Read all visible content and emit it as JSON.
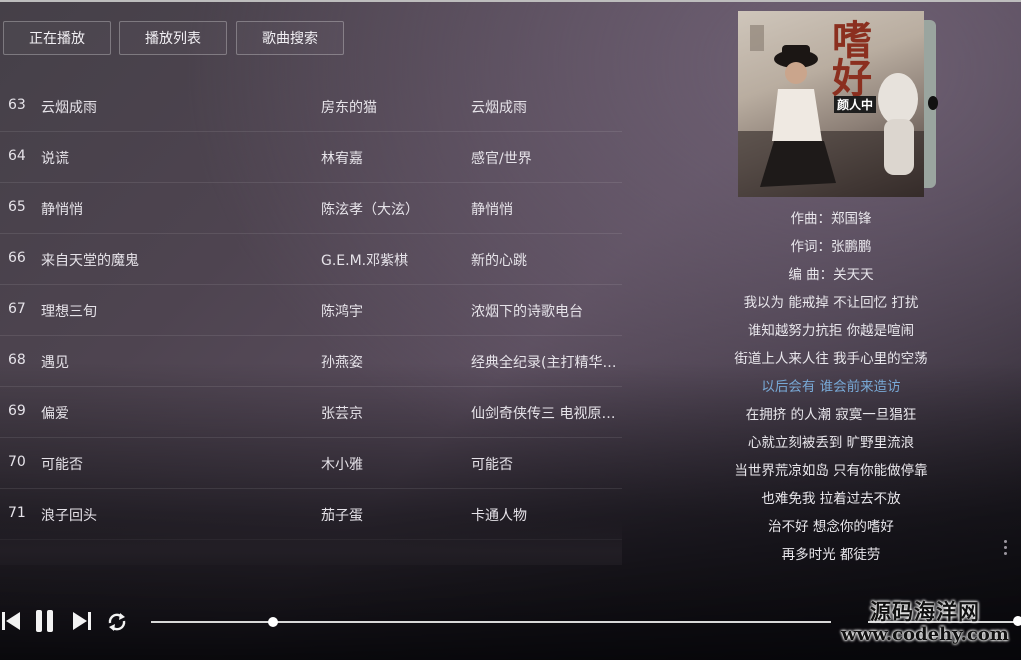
{
  "tabs": [
    {
      "label": "正在播放"
    },
    {
      "label": "播放列表"
    },
    {
      "label": "歌曲搜索"
    }
  ],
  "songs": [
    {
      "num": "63",
      "title": "云烟成雨",
      "artist": "房东的猫",
      "album": "云烟成雨"
    },
    {
      "num": "64",
      "title": "说谎",
      "artist": "林宥嘉",
      "album": "感官/世界"
    },
    {
      "num": "65",
      "title": "静悄悄",
      "artist": "陈泫孝（大泫）",
      "album": "静悄悄"
    },
    {
      "num": "66",
      "title": "来自天堂的魔鬼",
      "artist": "G.E.M.邓紫棋",
      "album": "新的心跳"
    },
    {
      "num": "67",
      "title": "理想三旬",
      "artist": "陈鸿宇",
      "album": "浓烟下的诗歌电台"
    },
    {
      "num": "68",
      "title": "遇见",
      "artist": "孙燕姿",
      "album": "经典全纪录(主打精华…"
    },
    {
      "num": "69",
      "title": "偏爱",
      "artist": "张芸京",
      "album": "仙剑奇侠传三 电视原…"
    },
    {
      "num": "70",
      "title": "可能否",
      "artist": "木小雅",
      "album": "可能否"
    },
    {
      "num": "71",
      "title": "浪子回头",
      "artist": "茄子蛋",
      "album": "卡通人物"
    }
  ],
  "cover": {
    "title": "嗜好",
    "artist": "颜人中"
  },
  "lyrics": {
    "active_index": 6,
    "lines": [
      "作曲：郑国锋",
      "作词：张鹏鹏",
      "编 曲：关天天",
      "我以为 能戒掉 不让回忆 打扰",
      "谁知越努力抗拒 你越是喧闹",
      "街道上人来人往 我手心里的空荡",
      "以后会有 谁会前来造访",
      "在拥挤 的人潮 寂寞一旦猖狂",
      "心就立刻被丢到 旷野里流浪",
      "当世界荒凉如岛 只有你能做停靠",
      "也难免我 拉着过去不放",
      "治不好 想念你的嗜好",
      "再多时光 都徒劳"
    ]
  },
  "player": {
    "progress": 0.18,
    "volume": 1.0,
    "icons": [
      "skip-previous-icon",
      "pause-icon",
      "skip-next-icon",
      "repeat-icon"
    ]
  },
  "watermark": {
    "line1": "源码海洋网",
    "line2": "www.codehy.com"
  }
}
